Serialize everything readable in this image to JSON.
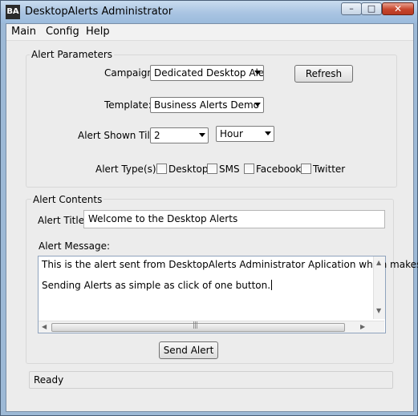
{
  "window": {
    "title": "DesktopAlerts Administrator",
    "app_icon": "BA",
    "controls": {
      "minimize": "–",
      "maximize": "□",
      "close": "✕"
    }
  },
  "menu": {
    "items": [
      "Main",
      "Config",
      "Help"
    ]
  },
  "alert_parameters": {
    "group_label": "Alert Parameters",
    "campaign_label": "Campaign:",
    "campaign_value": "Dedicated Desktop Alerts",
    "refresh_label": "Refresh",
    "template_label": "Template:",
    "template_value": "Business Alerts Demo",
    "shown_till_label": "Alert Shown Till:",
    "shown_till_value": "2",
    "shown_till_unit": "Hour",
    "types_label": "Alert Type(s):",
    "types": [
      {
        "label": "Desktop",
        "checked": false
      },
      {
        "label": "SMS",
        "checked": false
      },
      {
        "label": "Facebook",
        "checked": false
      },
      {
        "label": "Twitter",
        "checked": false
      }
    ]
  },
  "alert_contents": {
    "group_label": "Alert Contents",
    "title_label": "Alert Title:",
    "title_value": "Welcome to the Desktop Alerts",
    "message_label": "Alert Message:",
    "message_lines": [
      "This is the alert sent from DesktopAlerts Administrator Aplication which makes",
      "Sending Alerts as simple as click of one button."
    ],
    "send_label": "Send Alert"
  },
  "status": {
    "text": "Ready"
  }
}
